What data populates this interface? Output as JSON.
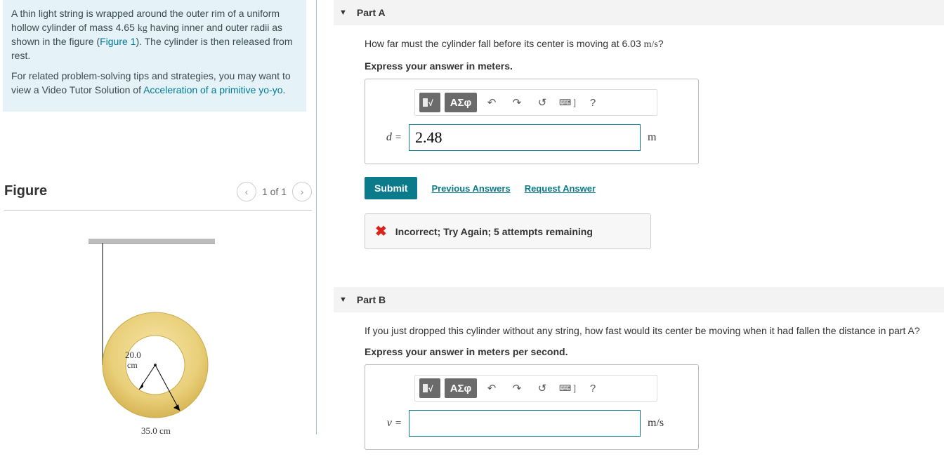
{
  "problem": {
    "text_a": "A thin light string is wrapped around the outer rim of a uniform hollow cylinder of mass 4.65 ",
    "mass_unit": "kg",
    "text_b": " having inner and outer radii as shown in the figure (",
    "figlink": "Figure 1",
    "text_c": "). The cylinder is then released from rest.",
    "tips_a": "For related problem-solving tips and strategies, you may want to view a Video Tutor Solution of ",
    "tips_link": "Acceleration of a primitive yo-yo",
    "tips_b": "."
  },
  "figure": {
    "heading": "Figure",
    "pager": "1 of 1",
    "inner_radius": "20.0",
    "inner_unit": "cm",
    "outer_label": "35.0 cm"
  },
  "partA": {
    "title": "Part A",
    "prompt_a": "How far must the cylinder fall before its center is moving at 6.03 ",
    "prompt_unit": "m/s",
    "prompt_b": "?",
    "instruction": "Express your answer in meters.",
    "var": "d",
    "value": "2.48",
    "unit": "m",
    "submit": "Submit",
    "prev": "Previous Answers",
    "request": "Request Answer",
    "feedback": "Incorrect; Try Again; 5 attempts remaining"
  },
  "partB": {
    "title": "Part B",
    "prompt": "If you just dropped this cylinder without any string, how fast would its center be moving when it had fallen the distance in part A?",
    "instruction": "Express your answer in meters per second.",
    "var": "v",
    "value": "",
    "unit": "m/s"
  },
  "toolbar": {
    "templates": "■√x",
    "greek": "ΑΣφ",
    "help": "?"
  }
}
